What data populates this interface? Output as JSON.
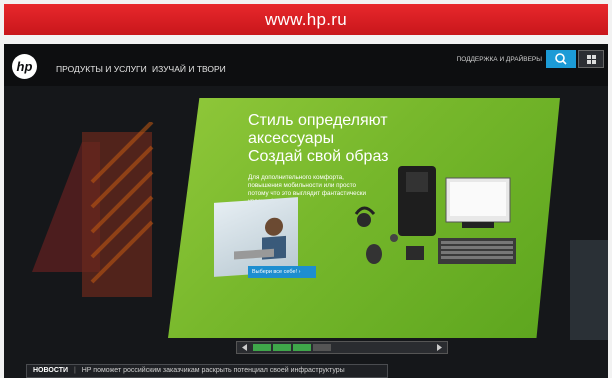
{
  "browser": {
    "url": "www.hp.ru"
  },
  "header": {
    "logo": "hp",
    "nav": [
      "ПРОДУКТЫ И УСЛУГИ",
      "ИЗУЧАЙ И ТВОРИ"
    ],
    "support": "ПОДДЕРЖКА И ДРАЙВЕРЫ"
  },
  "banner": {
    "title_line1": "Стиль определяют",
    "title_line2": "аксессуары",
    "title_line3": "Создай свой образ",
    "body": [
      "Для дополнительного комфорта,",
      "повышения мобильности или просто",
      "потому что это выглядит фантастически",
      "красиво!"
    ],
    "cta": "Выбери все себе! ›",
    "slides_total": 4,
    "active_slides": 3,
    "colors": {
      "green": "#7ab82f",
      "accent_blue": "#1d8ed0"
    }
  },
  "news": {
    "label": "НОВОСТИ",
    "separator": "|",
    "headline": "HP поможет российским заказчикам раскрыть потенциал своей инфраструктуры"
  },
  "icons": [
    "search-icon",
    "windows-icon",
    "prev-arrow-icon",
    "next-arrow-icon"
  ]
}
